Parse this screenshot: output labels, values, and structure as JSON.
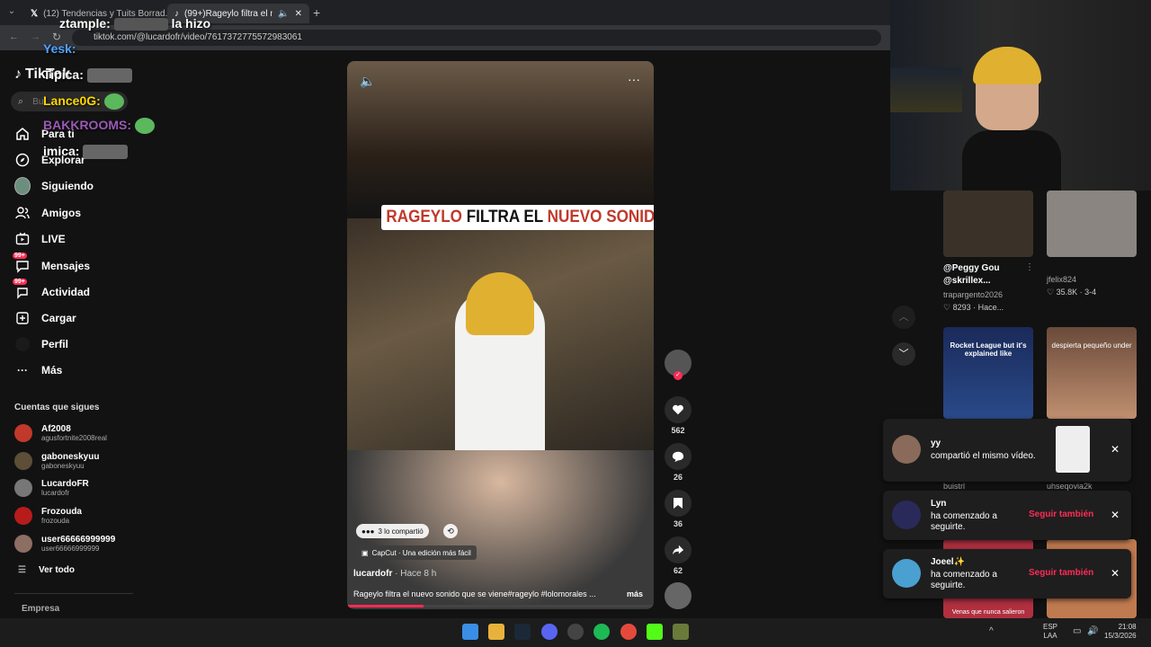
{
  "tabs": [
    {
      "title": "(12) Tendencias y Tuits Borrad...",
      "icon": "x-logo-icon"
    },
    {
      "title": "(99+)Rageylo filtra el nuevo s",
      "icon": "tiktok-icon"
    }
  ],
  "address": {
    "url": "tiktok.com/@lucardofr/video/7617372775572983061"
  },
  "brand": {
    "name": "TikTok"
  },
  "search": {
    "placeholder": "Bu"
  },
  "nav": [
    {
      "label": "Para ti",
      "icon": "home-icon"
    },
    {
      "label": "Explorar",
      "icon": "compass-icon"
    },
    {
      "label": "Siguiendo",
      "icon": "following-avatar-icon"
    },
    {
      "label": "Amigos",
      "icon": "friends-icon"
    },
    {
      "label": "LIVE",
      "icon": "live-icon"
    },
    {
      "label": "Mensajes",
      "icon": "message-icon",
      "badge": "99+"
    },
    {
      "label": "Actividad",
      "icon": "activity-icon",
      "badge": "99+"
    },
    {
      "label": "Cargar",
      "icon": "upload-icon"
    },
    {
      "label": "Perfil",
      "icon": "profile-icon"
    },
    {
      "label": "Más",
      "icon": "more-icon"
    }
  ],
  "following": {
    "title": "Cuentas que sigues",
    "accounts": [
      {
        "name": "Af2008",
        "handle": "agusfortnite2008real",
        "color": "#c0392b"
      },
      {
        "name": "gaboneskyuu",
        "handle": "gaboneskyuu",
        "color": "#5d4e37"
      },
      {
        "name": "LucardoFR",
        "handle": "lucardofr",
        "color": "#777777"
      },
      {
        "name": "Frozouda",
        "handle": "frozouda",
        "color": "#b71c1c"
      },
      {
        "name": "user66666999999",
        "handle": "user66666999999",
        "color": "#8d6e63"
      }
    ],
    "see_all": "Ver todo"
  },
  "footer": {
    "company": "Empresa"
  },
  "chat": [
    {
      "user": "ztample:",
      "msg": "la hizo",
      "color": "#ffffff"
    },
    {
      "user": "Yesk:",
      "msg": "",
      "color": "#4ea3ff"
    },
    {
      "user": "Tipica:",
      "msg": "",
      "color": "#ffffff"
    },
    {
      "user": "Lance0G:",
      "msg": "",
      "color": "#ffd700"
    },
    {
      "user": "BAKKROOMS:",
      "msg": "",
      "color": "#9b59b6"
    },
    {
      "user": "imica:",
      "msg": "",
      "color": "#ffffff"
    }
  ],
  "video": {
    "headline": {
      "part1": "RAGEYLO",
      "part2": " FILTRA EL ",
      "part3": "NUEVO SONIDO"
    },
    "shared": "3 lo compartió",
    "capcut": "CapCut · Una edición más fácil",
    "author": "lucardofr",
    "time": "· Hace 8 h",
    "caption": "Rageylo filtra el nuevo sonido que se viene#rageylo #lolomorales ...",
    "more": "más",
    "progress": 0.25
  },
  "actions": [
    {
      "name": "like",
      "icon": "heart-icon",
      "count": "562"
    },
    {
      "name": "comment",
      "icon": "comment-icon",
      "count": "26"
    },
    {
      "name": "save",
      "icon": "bookmark-icon",
      "count": "36"
    },
    {
      "name": "share",
      "icon": "share-icon",
      "count": "62"
    }
  ],
  "related": [
    {
      "title": "@Peggy Gou @skrillex...",
      "author": "trapargento2026",
      "likes": "8293",
      "time": "Hace..."
    },
    {
      "title": "",
      "author": "jfelix824",
      "likes": "35.8K",
      "time": "3-4"
    },
    {
      "title": "Rocket League but it's explained like",
      "author": "buistrl",
      "likes": "",
      "time": ""
    },
    {
      "title": "despierta pequeño under",
      "author": "uhseqovia2k",
      "likes": "",
      "time": ""
    },
    {
      "title": "Venas que nunca salieron",
      "author": "",
      "likes": "",
      "time": ""
    }
  ],
  "notifications": [
    {
      "name": "yy",
      "text": "compartió el mismo vídeo.",
      "action": ""
    },
    {
      "name": "Lyn",
      "text": "ha comenzado a seguirte.",
      "action": "Seguir también"
    },
    {
      "name": "Joeel✨",
      "text": "ha comenzado a seguirte.",
      "action": "Seguir también"
    }
  ],
  "taskbar": {
    "lang1": "ESP",
    "lang2": "LAA",
    "time": "21:08",
    "date": "15/3/2026"
  },
  "colors": {
    "accent": "#fe2c55",
    "red_text": "#c0392b",
    "bg": "#121212"
  }
}
